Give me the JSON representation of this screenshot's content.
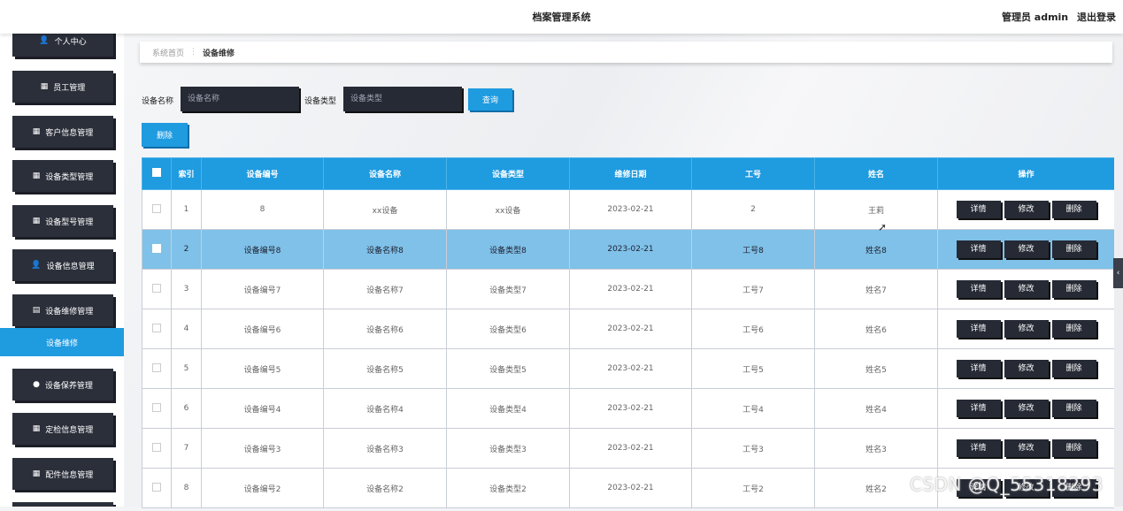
{
  "header": {
    "app_title": "档案管理系统",
    "user_label": "管理员 admin",
    "logout_label": "退出登录"
  },
  "sidebar": {
    "items": [
      {
        "label": "个人中心",
        "icon": "👤"
      },
      {
        "label": "员工管理",
        "icon": "▦"
      },
      {
        "label": "客户信息管理",
        "icon": "▦"
      },
      {
        "label": "设备类型管理",
        "icon": "▦"
      },
      {
        "label": "设备型号管理",
        "icon": "▦"
      },
      {
        "label": "设备信息管理",
        "icon": "👤"
      },
      {
        "label": "设备维修管理",
        "icon": "▤"
      },
      {
        "label": "设备保养管理",
        "icon": "●"
      },
      {
        "label": "定检信息管理",
        "icon": "▦"
      },
      {
        "label": "配件信息管理",
        "icon": "▦"
      }
    ],
    "active_submenu": "设备维修"
  },
  "breadcrumb": {
    "home": "系统首页",
    "separator": "⋮",
    "current": "设备维修"
  },
  "search": {
    "name_label": "设备名称",
    "name_placeholder": "设备名称",
    "type_label": "设备类型",
    "type_placeholder": "设备类型",
    "query_label": "查询",
    "delete_label": "删除"
  },
  "table": {
    "headers": [
      "索引",
      "设备编号",
      "设备名称",
      "设备类型",
      "维修日期",
      "工号",
      "姓名",
      "操作"
    ],
    "actions": {
      "detail": "详情",
      "edit": "修改",
      "delete": "删除"
    },
    "rows": [
      {
        "index": "1",
        "code": "8",
        "name": "xx设备",
        "type": "xx设备",
        "date": "2023-02-21",
        "job_no": "2",
        "person": "王莉"
      },
      {
        "index": "2",
        "code": "设备编号8",
        "name": "设备名称8",
        "type": "设备类型8",
        "date": "2023-02-21",
        "job_no": "工号8",
        "person": "姓名8"
      },
      {
        "index": "3",
        "code": "设备编号7",
        "name": "设备名称7",
        "type": "设备类型7",
        "date": "2023-02-21",
        "job_no": "工号7",
        "person": "姓名7"
      },
      {
        "index": "4",
        "code": "设备编号6",
        "name": "设备名称6",
        "type": "设备类型6",
        "date": "2023-02-21",
        "job_no": "工号6",
        "person": "姓名6"
      },
      {
        "index": "5",
        "code": "设备编号5",
        "name": "设备名称5",
        "type": "设备类型5",
        "date": "2023-02-21",
        "job_no": "工号5",
        "person": "姓名5"
      },
      {
        "index": "6",
        "code": "设备编号4",
        "name": "设备名称4",
        "type": "设备类型4",
        "date": "2023-02-21",
        "job_no": "工号4",
        "person": "姓名4"
      },
      {
        "index": "7",
        "code": "设备编号3",
        "name": "设备名称3",
        "type": "设备类型3",
        "date": "2023-02-21",
        "job_no": "工号3",
        "person": "姓名3"
      },
      {
        "index": "8",
        "code": "设备编号2",
        "name": "设备名称2",
        "type": "设备类型2",
        "date": "2023-02-21",
        "job_no": "工号2",
        "person": "姓名2"
      }
    ]
  },
  "watermark": "CSDN @Q_55318293",
  "colors": {
    "accent": "#1f9be0",
    "dark_button": "#262a35",
    "selected_row": "#7fc1e8"
  }
}
